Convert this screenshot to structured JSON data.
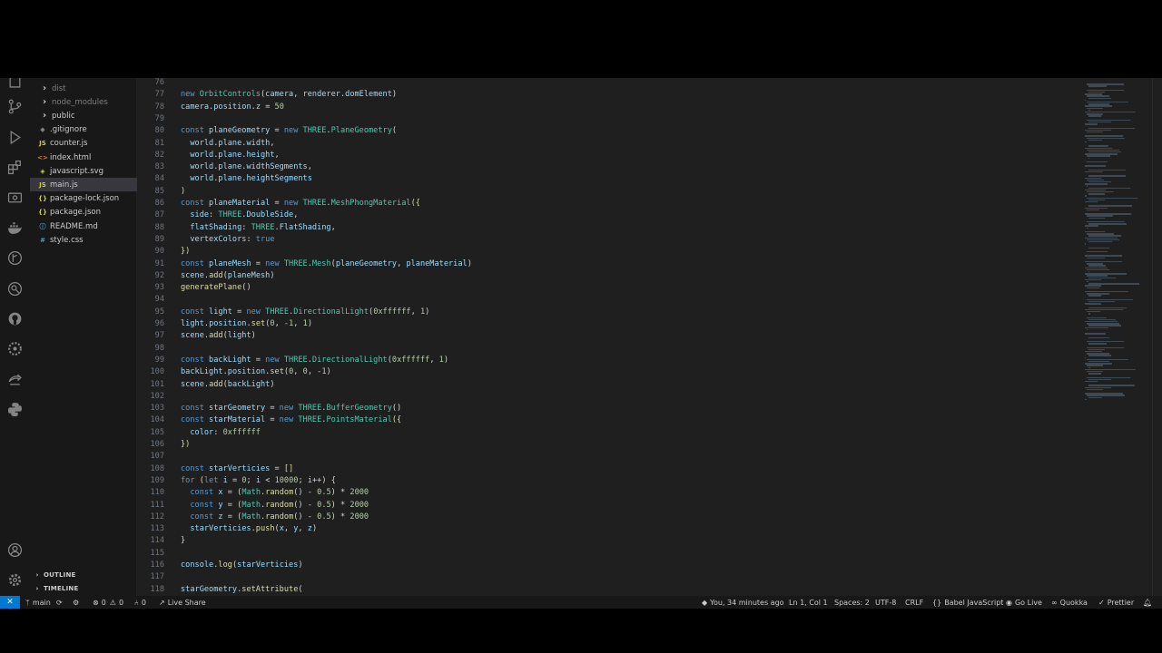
{
  "explorer": {
    "items": [
      {
        "label": "dist",
        "type": "folder",
        "icon": "›",
        "dim": true
      },
      {
        "label": "node_modules",
        "type": "folder",
        "icon": "›",
        "dim": true
      },
      {
        "label": "public",
        "type": "folder",
        "icon": "›"
      },
      {
        "label": ".gitignore",
        "type": "file",
        "icon": "◆"
      },
      {
        "label": "counter.js",
        "type": "file",
        "icon": "JS"
      },
      {
        "label": "index.html",
        "type": "file",
        "icon": "<>"
      },
      {
        "label": "javascript.svg",
        "type": "file",
        "icon": "◈"
      },
      {
        "label": "main.js",
        "type": "file",
        "icon": "JS",
        "active": true
      },
      {
        "label": "package-lock.json",
        "type": "file",
        "icon": "{}"
      },
      {
        "label": "package.json",
        "type": "file",
        "icon": "{}"
      },
      {
        "label": "README.md",
        "type": "file",
        "icon": "ⓘ"
      },
      {
        "label": "style.css",
        "type": "file",
        "icon": "#"
      }
    ],
    "outline_label": "OUTLINE",
    "timeline_label": "TIMELINE"
  },
  "colors": {
    "keyword": "#569cd6",
    "variable": "#9cdcfe",
    "function": "#dcdcaa",
    "class": "#4ec9b0",
    "number": "#b5cea8",
    "text": "#d4d4d4",
    "accent": "#0078d4"
  },
  "code_lines": [
    {
      "n": "76",
      "s": []
    },
    {
      "n": "77",
      "s": [
        [
          "new ",
          "keyword"
        ],
        [
          "OrbitControls",
          "class"
        ],
        [
          "(",
          "text"
        ],
        [
          "camera",
          "variable"
        ],
        [
          ", ",
          "text"
        ],
        [
          "renderer",
          "variable"
        ],
        [
          ".",
          "text"
        ],
        [
          "domElement",
          "variable"
        ],
        [
          ")",
          "text"
        ]
      ]
    },
    {
      "n": "78",
      "s": [
        [
          "camera",
          "variable"
        ],
        [
          ".",
          "text"
        ],
        [
          "position",
          "variable"
        ],
        [
          ".",
          "text"
        ],
        [
          "z",
          "variable"
        ],
        [
          " = ",
          "text"
        ],
        [
          "50",
          "number"
        ]
      ]
    },
    {
      "n": "79",
      "s": []
    },
    {
      "n": "80",
      "s": [
        [
          "const ",
          "keyword"
        ],
        [
          "planeGeometry",
          "variable"
        ],
        [
          " = ",
          "text"
        ],
        [
          "new ",
          "keyword"
        ],
        [
          "THREE",
          "class"
        ],
        [
          ".",
          "text"
        ],
        [
          "PlaneGeometry",
          "class"
        ],
        [
          "(",
          "text"
        ]
      ]
    },
    {
      "n": "81",
      "s": [
        [
          "  world",
          "variable"
        ],
        [
          ".",
          "text"
        ],
        [
          "plane",
          "variable"
        ],
        [
          ".",
          "text"
        ],
        [
          "width",
          "variable"
        ],
        [
          ",",
          "text"
        ]
      ]
    },
    {
      "n": "82",
      "s": [
        [
          "  world",
          "variable"
        ],
        [
          ".",
          "text"
        ],
        [
          "plane",
          "variable"
        ],
        [
          ".",
          "text"
        ],
        [
          "height",
          "variable"
        ],
        [
          ",",
          "text"
        ]
      ]
    },
    {
      "n": "83",
      "s": [
        [
          "  world",
          "variable"
        ],
        [
          ".",
          "text"
        ],
        [
          "plane",
          "variable"
        ],
        [
          ".",
          "text"
        ],
        [
          "widthSegments",
          "variable"
        ],
        [
          ",",
          "text"
        ]
      ]
    },
    {
      "n": "84",
      "s": [
        [
          "  world",
          "variable"
        ],
        [
          ".",
          "text"
        ],
        [
          "plane",
          "variable"
        ],
        [
          ".",
          "text"
        ],
        [
          "heightSegments",
          "variable"
        ]
      ]
    },
    {
      "n": "85",
      "s": [
        [
          ")",
          "function"
        ]
      ]
    },
    {
      "n": "86",
      "s": [
        [
          "const ",
          "keyword"
        ],
        [
          "planeMaterial",
          "variable"
        ],
        [
          " = ",
          "text"
        ],
        [
          "new ",
          "keyword"
        ],
        [
          "THREE",
          "class"
        ],
        [
          ".",
          "text"
        ],
        [
          "MeshPhongMaterial",
          "class"
        ],
        [
          "({",
          "function"
        ]
      ]
    },
    {
      "n": "87",
      "s": [
        [
          "  side",
          "variable"
        ],
        [
          ": ",
          "text"
        ],
        [
          "THREE",
          "class"
        ],
        [
          ".",
          "text"
        ],
        [
          "DoubleSide",
          "variable"
        ],
        [
          ",",
          "text"
        ]
      ]
    },
    {
      "n": "88",
      "s": [
        [
          "  flatShading",
          "variable"
        ],
        [
          ": ",
          "text"
        ],
        [
          "THREE",
          "class"
        ],
        [
          ".",
          "text"
        ],
        [
          "FlatShading",
          "variable"
        ],
        [
          ",",
          "text"
        ]
      ]
    },
    {
      "n": "89",
      "s": [
        [
          "  vertexColors",
          "variable"
        ],
        [
          ": ",
          "text"
        ],
        [
          "true",
          "keyword"
        ]
      ]
    },
    {
      "n": "90",
      "s": [
        [
          "})",
          "function"
        ]
      ]
    },
    {
      "n": "91",
      "s": [
        [
          "const ",
          "keyword"
        ],
        [
          "planeMesh",
          "variable"
        ],
        [
          " = ",
          "text"
        ],
        [
          "new ",
          "keyword"
        ],
        [
          "THREE",
          "class"
        ],
        [
          ".",
          "text"
        ],
        [
          "Mesh",
          "class"
        ],
        [
          "(",
          "text"
        ],
        [
          "planeGeometry",
          "variable"
        ],
        [
          ", ",
          "text"
        ],
        [
          "planeMaterial",
          "variable"
        ],
        [
          ")",
          "text"
        ]
      ]
    },
    {
      "n": "92",
      "s": [
        [
          "scene",
          "variable"
        ],
        [
          ".",
          "text"
        ],
        [
          "add",
          "function"
        ],
        [
          "(",
          "text"
        ],
        [
          "planeMesh",
          "variable"
        ],
        [
          ")",
          "text"
        ]
      ]
    },
    {
      "n": "93",
      "s": [
        [
          "generatePlane",
          "function"
        ],
        [
          "()",
          "text"
        ]
      ]
    },
    {
      "n": "94",
      "s": []
    },
    {
      "n": "95",
      "s": [
        [
          "const ",
          "keyword"
        ],
        [
          "light",
          "variable"
        ],
        [
          " = ",
          "text"
        ],
        [
          "new ",
          "keyword"
        ],
        [
          "THREE",
          "class"
        ],
        [
          ".",
          "text"
        ],
        [
          "DirectionalLight",
          "class"
        ],
        [
          "(",
          "text"
        ],
        [
          "0xffffff",
          "number"
        ],
        [
          ", ",
          "text"
        ],
        [
          "1",
          "number"
        ],
        [
          ")",
          "text"
        ]
      ]
    },
    {
      "n": "96",
      "s": [
        [
          "light",
          "variable"
        ],
        [
          ".",
          "text"
        ],
        [
          "position",
          "variable"
        ],
        [
          ".",
          "text"
        ],
        [
          "set",
          "function"
        ],
        [
          "(",
          "text"
        ],
        [
          "0",
          "number"
        ],
        [
          ", ",
          "text"
        ],
        [
          "-1",
          "number"
        ],
        [
          ", ",
          "text"
        ],
        [
          "1",
          "number"
        ],
        [
          ")",
          "text"
        ]
      ]
    },
    {
      "n": "97",
      "s": [
        [
          "scene",
          "variable"
        ],
        [
          ".",
          "text"
        ],
        [
          "add",
          "function"
        ],
        [
          "(",
          "text"
        ],
        [
          "light",
          "variable"
        ],
        [
          ")",
          "text"
        ]
      ]
    },
    {
      "n": "98",
      "s": []
    },
    {
      "n": "99",
      "s": [
        [
          "const ",
          "keyword"
        ],
        [
          "backLight",
          "variable"
        ],
        [
          " = ",
          "text"
        ],
        [
          "new ",
          "keyword"
        ],
        [
          "THREE",
          "class"
        ],
        [
          ".",
          "text"
        ],
        [
          "DirectionalLight",
          "class"
        ],
        [
          "(",
          "text"
        ],
        [
          "0xffffff",
          "number"
        ],
        [
          ", ",
          "text"
        ],
        [
          "1",
          "number"
        ],
        [
          ")",
          "text"
        ]
      ]
    },
    {
      "n": "100",
      "s": [
        [
          "backLight",
          "variable"
        ],
        [
          ".",
          "text"
        ],
        [
          "position",
          "variable"
        ],
        [
          ".",
          "text"
        ],
        [
          "set",
          "function"
        ],
        [
          "(",
          "text"
        ],
        [
          "0",
          "number"
        ],
        [
          ", ",
          "text"
        ],
        [
          "0",
          "number"
        ],
        [
          ", ",
          "text"
        ],
        [
          "-1",
          "number"
        ],
        [
          ")",
          "text"
        ]
      ]
    },
    {
      "n": "101",
      "s": [
        [
          "scene",
          "variable"
        ],
        [
          ".",
          "text"
        ],
        [
          "add",
          "function"
        ],
        [
          "(",
          "text"
        ],
        [
          "backLight",
          "variable"
        ],
        [
          ")",
          "text"
        ]
      ]
    },
    {
      "n": "102",
      "s": []
    },
    {
      "n": "103",
      "s": [
        [
          "const ",
          "keyword"
        ],
        [
          "starGeometry",
          "variable"
        ],
        [
          " = ",
          "text"
        ],
        [
          "new ",
          "keyword"
        ],
        [
          "THREE",
          "class"
        ],
        [
          ".",
          "text"
        ],
        [
          "BufferGeometry",
          "class"
        ],
        [
          "()",
          "text"
        ]
      ]
    },
    {
      "n": "104",
      "s": [
        [
          "const ",
          "keyword"
        ],
        [
          "starMaterial",
          "variable"
        ],
        [
          " = ",
          "text"
        ],
        [
          "new ",
          "keyword"
        ],
        [
          "THREE",
          "class"
        ],
        [
          ".",
          "text"
        ],
        [
          "PointsMaterial",
          "class"
        ],
        [
          "({",
          "function"
        ]
      ]
    },
    {
      "n": "105",
      "s": [
        [
          "  color",
          "variable"
        ],
        [
          ": ",
          "text"
        ],
        [
          "0xffffff",
          "number"
        ]
      ]
    },
    {
      "n": "106",
      "s": [
        [
          "})",
          "function"
        ]
      ]
    },
    {
      "n": "107",
      "s": []
    },
    {
      "n": "108",
      "s": [
        [
          "const ",
          "keyword"
        ],
        [
          "starVerticies",
          "variable"
        ],
        [
          " = ",
          "text"
        ],
        [
          "[]",
          "function"
        ]
      ]
    },
    {
      "n": "109",
      "s": [
        [
          "for ",
          "keyword"
        ],
        [
          "(",
          "function"
        ],
        [
          "let ",
          "keyword"
        ],
        [
          "i",
          "variable"
        ],
        [
          " = ",
          "text"
        ],
        [
          "0",
          "number"
        ],
        [
          "; ",
          "text"
        ],
        [
          "i",
          "variable"
        ],
        [
          " < ",
          "text"
        ],
        [
          "10000",
          "number"
        ],
        [
          "; ",
          "text"
        ],
        [
          "i",
          "variable"
        ],
        [
          "++",
          "text"
        ],
        [
          ") {",
          "function"
        ]
      ]
    },
    {
      "n": "110",
      "s": [
        [
          "  const ",
          "keyword"
        ],
        [
          "x",
          "variable"
        ],
        [
          " = ",
          "text"
        ],
        [
          "(",
          "function"
        ],
        [
          "Math",
          "class"
        ],
        [
          ".",
          "text"
        ],
        [
          "random",
          "function"
        ],
        [
          "() ",
          "text"
        ],
        [
          "- ",
          "text"
        ],
        [
          "0.5",
          "number"
        ],
        [
          ") ",
          "function"
        ],
        [
          "* ",
          "text"
        ],
        [
          "2000",
          "number"
        ]
      ]
    },
    {
      "n": "111",
      "s": [
        [
          "  const ",
          "keyword"
        ],
        [
          "y",
          "variable"
        ],
        [
          " = ",
          "text"
        ],
        [
          "(",
          "function"
        ],
        [
          "Math",
          "class"
        ],
        [
          ".",
          "text"
        ],
        [
          "random",
          "function"
        ],
        [
          "() ",
          "text"
        ],
        [
          "- ",
          "text"
        ],
        [
          "0.5",
          "number"
        ],
        [
          ") ",
          "function"
        ],
        [
          "* ",
          "text"
        ],
        [
          "2000",
          "number"
        ]
      ]
    },
    {
      "n": "112",
      "s": [
        [
          "  const ",
          "keyword"
        ],
        [
          "z",
          "variable"
        ],
        [
          " = ",
          "text"
        ],
        [
          "(",
          "function"
        ],
        [
          "Math",
          "class"
        ],
        [
          ".",
          "text"
        ],
        [
          "random",
          "function"
        ],
        [
          "() ",
          "text"
        ],
        [
          "- ",
          "text"
        ],
        [
          "0.5",
          "number"
        ],
        [
          ") ",
          "function"
        ],
        [
          "* ",
          "text"
        ],
        [
          "2000",
          "number"
        ]
      ]
    },
    {
      "n": "113",
      "s": [
        [
          "  starVerticies",
          "variable"
        ],
        [
          ".",
          "text"
        ],
        [
          "push",
          "function"
        ],
        [
          "(",
          "text"
        ],
        [
          "x",
          "variable"
        ],
        [
          ", ",
          "text"
        ],
        [
          "y",
          "variable"
        ],
        [
          ", ",
          "text"
        ],
        [
          "z",
          "variable"
        ],
        [
          ")",
          "text"
        ]
      ]
    },
    {
      "n": "114",
      "s": [
        [
          "}",
          "function"
        ]
      ]
    },
    {
      "n": "115",
      "s": []
    },
    {
      "n": "116",
      "s": [
        [
          "console",
          "variable"
        ],
        [
          ".",
          "text"
        ],
        [
          "log",
          "function"
        ],
        [
          "(",
          "text"
        ],
        [
          "starVerticies",
          "variable"
        ],
        [
          ")",
          "text"
        ]
      ]
    },
    {
      "n": "117",
      "s": []
    },
    {
      "n": "118",
      "s": [
        [
          "starGeometry",
          "variable"
        ],
        [
          ".",
          "text"
        ],
        [
          "setAttribute",
          "function"
        ],
        [
          "(",
          "text"
        ]
      ]
    }
  ],
  "statusbar": {
    "branch": "main",
    "errors": "0",
    "warnings": "0",
    "ports": "0",
    "live_share": "Live Share",
    "blame": "You, 34 minutes ago",
    "position": "Ln 1, Col 1",
    "spaces": "Spaces: 2",
    "encoding": "UTF-8",
    "eol": "CRLF",
    "language": "Babel JavaScript",
    "go_live": "Go Live",
    "quokka": "Quokka",
    "prettier": "Prettier"
  }
}
